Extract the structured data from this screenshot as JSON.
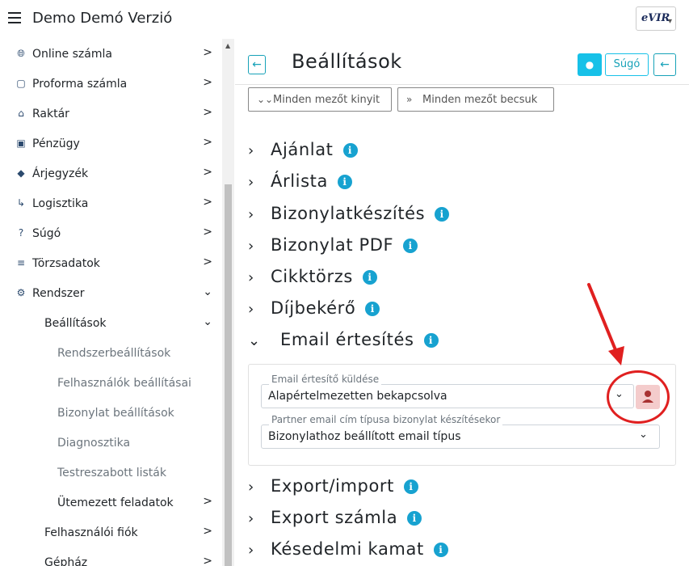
{
  "app": {
    "title": "Demo Demó Verzió",
    "logo_text": "eVIR"
  },
  "sidebar": {
    "items": [
      {
        "label": "Online számla",
        "icon": "globe-icon",
        "chevron": "›"
      },
      {
        "label": "Proforma számla",
        "icon": "document-icon",
        "chevron": "›"
      },
      {
        "label": "Raktár",
        "icon": "warehouse-icon",
        "chevron": "›"
      },
      {
        "label": "Pénzügy",
        "icon": "money-icon",
        "chevron": "›"
      },
      {
        "label": "Árjegyzék",
        "icon": "tags-icon",
        "chevron": "›"
      },
      {
        "label": "Logisztika",
        "icon": "dolly-icon",
        "chevron": "›"
      },
      {
        "label": "Súgó",
        "icon": "question-icon",
        "chevron": "›"
      },
      {
        "label": "Törzsadatok",
        "icon": "database-icon",
        "chevron": "›"
      },
      {
        "label": "Rendszer",
        "icon": "cogs-icon",
        "chevron": "⌄"
      },
      {
        "label": "Beállítások",
        "chevron": "⌄"
      },
      {
        "label": "Rendszerbeállítások"
      },
      {
        "label": "Felhasználók beállításai"
      },
      {
        "label": "Bizonylat beállítások"
      },
      {
        "label": "Diagnosztika"
      },
      {
        "label": "Testreszabott listák"
      },
      {
        "label": "Ütemezett feladatok",
        "chevron": "›"
      },
      {
        "label": "Felhasználói fiók",
        "chevron": "›"
      },
      {
        "label": "Gépház",
        "chevron": "›"
      }
    ]
  },
  "main": {
    "title": "Beállítások",
    "help_label": "Súgó",
    "expand_all_label": "Minden mezőt kinyit",
    "collapse_all_label": "Minden mezőt becsuk",
    "sections": [
      {
        "label": "Ajánlat",
        "expanded": false
      },
      {
        "label": "Árlista",
        "expanded": false
      },
      {
        "label": "Bizonylatkészítés",
        "expanded": false
      },
      {
        "label": "Bizonylat PDF",
        "expanded": false
      },
      {
        "label": "Cikktörzs",
        "expanded": false
      },
      {
        "label": "Díjbekérő",
        "expanded": false
      },
      {
        "label": "Email értesítés",
        "expanded": true
      },
      {
        "label": "Export/import",
        "expanded": false
      },
      {
        "label": "Export számla",
        "expanded": false
      },
      {
        "label": "Késedelmi kamat",
        "expanded": false
      }
    ],
    "email_panel": {
      "field1_label": "Email értesítő küldése",
      "field1_value": "Alapértelmezetten bekapcsolva",
      "field2_label": "Partner email cím típusa bizonylat készítésekor",
      "field2_value": "Bizonylathoz beállított email típus"
    }
  },
  "colors": {
    "accent": "#17a2b8",
    "info": "#17a2d0",
    "highlight": "#e02020",
    "person_bg": "#f4cccc"
  }
}
